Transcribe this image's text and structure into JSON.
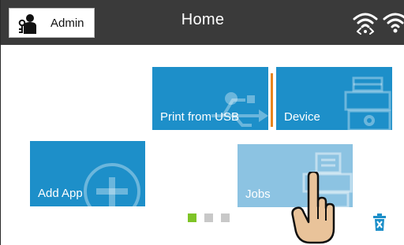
{
  "header": {
    "admin_label": "Admin",
    "title": "Home",
    "icons": [
      "admin-user-icon",
      "wifi-direct-icon",
      "wifi-icon"
    ]
  },
  "tiles": [
    {
      "label": "Print from USB",
      "icon": "usb-icon"
    },
    {
      "label": "Device",
      "icon": "printer-settings-icon"
    },
    {
      "label": "Add App",
      "icon": "plus-circle-icon"
    },
    {
      "label": "Jobs",
      "icon": "jobs-icon",
      "selected": true
    }
  ],
  "pager": {
    "pages": 3,
    "current": 1
  },
  "footer": {
    "icon": "trash-icon"
  },
  "colors": {
    "topbar": "#3a3a3a",
    "tile": "#1d8fc9",
    "tile_selected": "#8cc3e2",
    "divider": "#e8851d",
    "page_active": "#7ec427",
    "page_inactive": "#c8c8c8",
    "trash": "#1d8fc9"
  }
}
